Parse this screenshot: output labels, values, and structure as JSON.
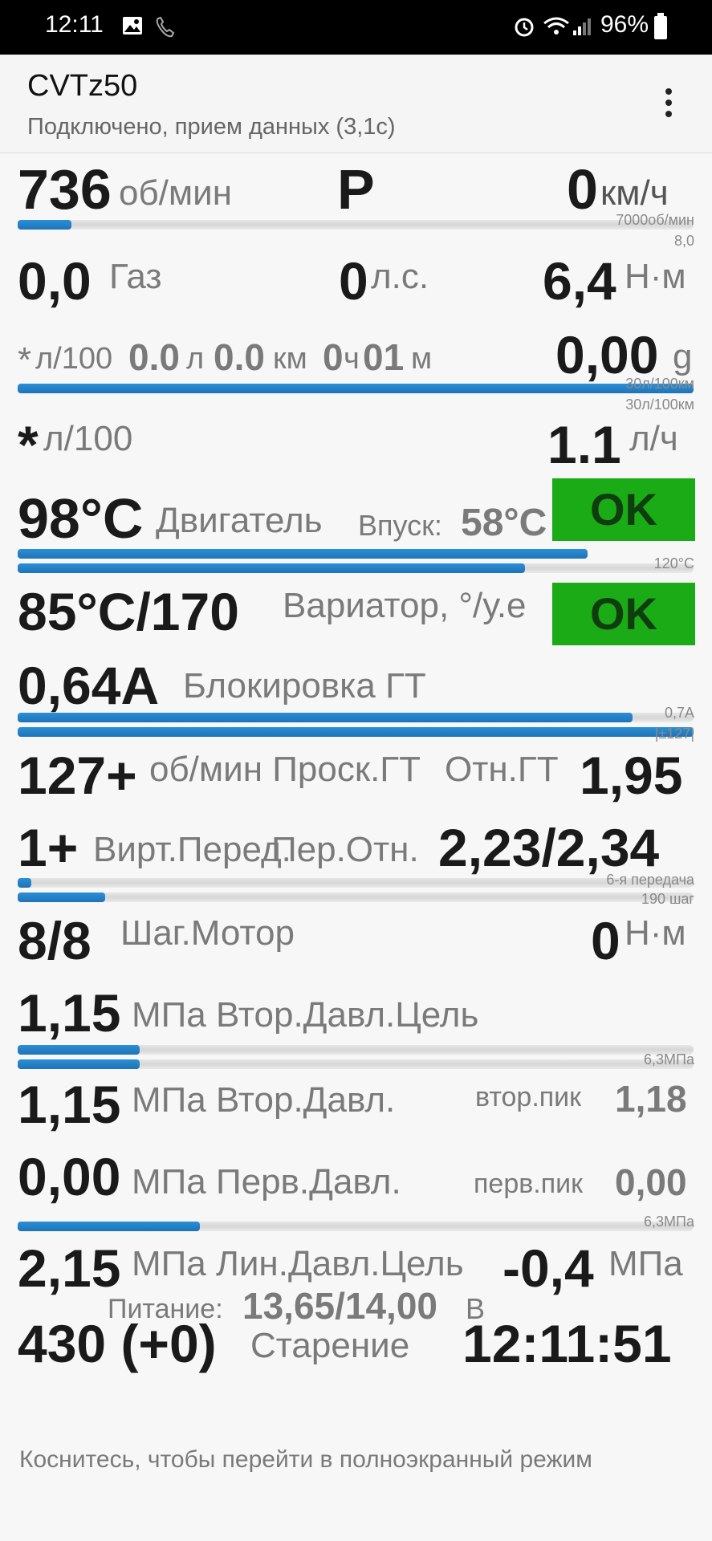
{
  "status_bar": {
    "time": "12:11",
    "battery": "96%"
  },
  "app_bar": {
    "title": "CVTz50",
    "subtitle": "Подключено, прием данных (3,1с)"
  },
  "rows": {
    "rpm": {
      "value": "736",
      "unit": "об/мин",
      "gear": "P",
      "speed": "0",
      "speed_unit": "км/ч",
      "scale": "7000об/мин",
      "scale2": "8,0",
      "bar_fraction": 0.1
    },
    "throttle": {
      "value": "0,0",
      "label": "Газ",
      "power": "0",
      "power_unit": "л.с.",
      "torque": "6,4",
      "torque_unit": "Н·м"
    },
    "consumption": {
      "prefix": "*",
      "unit1": "л/100",
      "fuel": "0.0",
      "fuel_unit": "л",
      "distance": "0.0",
      "distance_unit": "км",
      "hours": "0",
      "hours_unit": "ч",
      "minutes": "01",
      "minutes_unit": "м",
      "g_value": "0,00",
      "g_unit": "g",
      "scale_a": "30л/100км",
      "scale_b": "30л/100км",
      "bar_fraction": 1.0
    },
    "instant": {
      "prefix": "*",
      "unit": "л/100",
      "rate": "1.1",
      "rate_unit": "л/ч"
    },
    "engine": {
      "temp": "98°C",
      "label": "Двигатель",
      "intake_label": "Впуск:",
      "intake_value": "58°C",
      "status": "OK",
      "scale": "120°C",
      "bar1_fraction": 0.84,
      "bar2_fraction": 0.75
    },
    "cvt": {
      "temp": "85°C/170",
      "label": "Вариатор, °/у.е",
      "status": "OK"
    },
    "lockup": {
      "value": "0,64A",
      "label": "Блокировка ГТ",
      "scale_a": "0,7A",
      "scale_b": "|±127|",
      "bar1_fraction": 0.91,
      "bar2_fraction": 1.0
    },
    "slip": {
      "value": "127+",
      "label": "об/мин Проск.ГТ",
      "ratio_label": "Отн.ГТ",
      "ratio_value": "1,95"
    },
    "virtual_gear": {
      "value": "1+",
      "label": "Вирт.Перед.",
      "ratio_label": "Пер.Отн.",
      "ratio_value": "2,23/2,34",
      "scale_a": "6-я передача",
      "scale_b": "190 шаг",
      "bar1_fraction": 0.02,
      "bar2_fraction": 0.13
    },
    "step_motor": {
      "value": "8/8",
      "label": "Шаг.Мотор",
      "torque": "0",
      "torque_unit": "Н·м"
    },
    "secondary_target": {
      "value": "1,15",
      "label": "МПа Втор.Давл.Цель",
      "scale": "6,3МПа",
      "bar1_fraction": 0.18,
      "bar2_fraction": 0.18
    },
    "secondary": {
      "value": "1,15",
      "label": "МПа Втор.Давл.",
      "peak_label": "втор.пик",
      "peak_value": "1,18"
    },
    "primary": {
      "value": "0,00",
      "label": "МПа Перв.Давл.",
      "peak_label": "перв.пик",
      "peak_value": "0,00",
      "scale": "6,3МПа",
      "bar_fraction": 0.33
    },
    "line_target": {
      "value": "2,15",
      "label": "МПа Лин.Давл.Цель",
      "delta": "-0,4",
      "delta_unit": "МПа",
      "power_label": "Питание:",
      "power_value": "13,65/14,00",
      "power_unit": "В"
    },
    "aging": {
      "value": "430 (+0)",
      "label": "Старение",
      "clock": "12:11:51"
    }
  },
  "footer_hint": "Коснитесь, чтобы перейти в полноэкранный режим"
}
